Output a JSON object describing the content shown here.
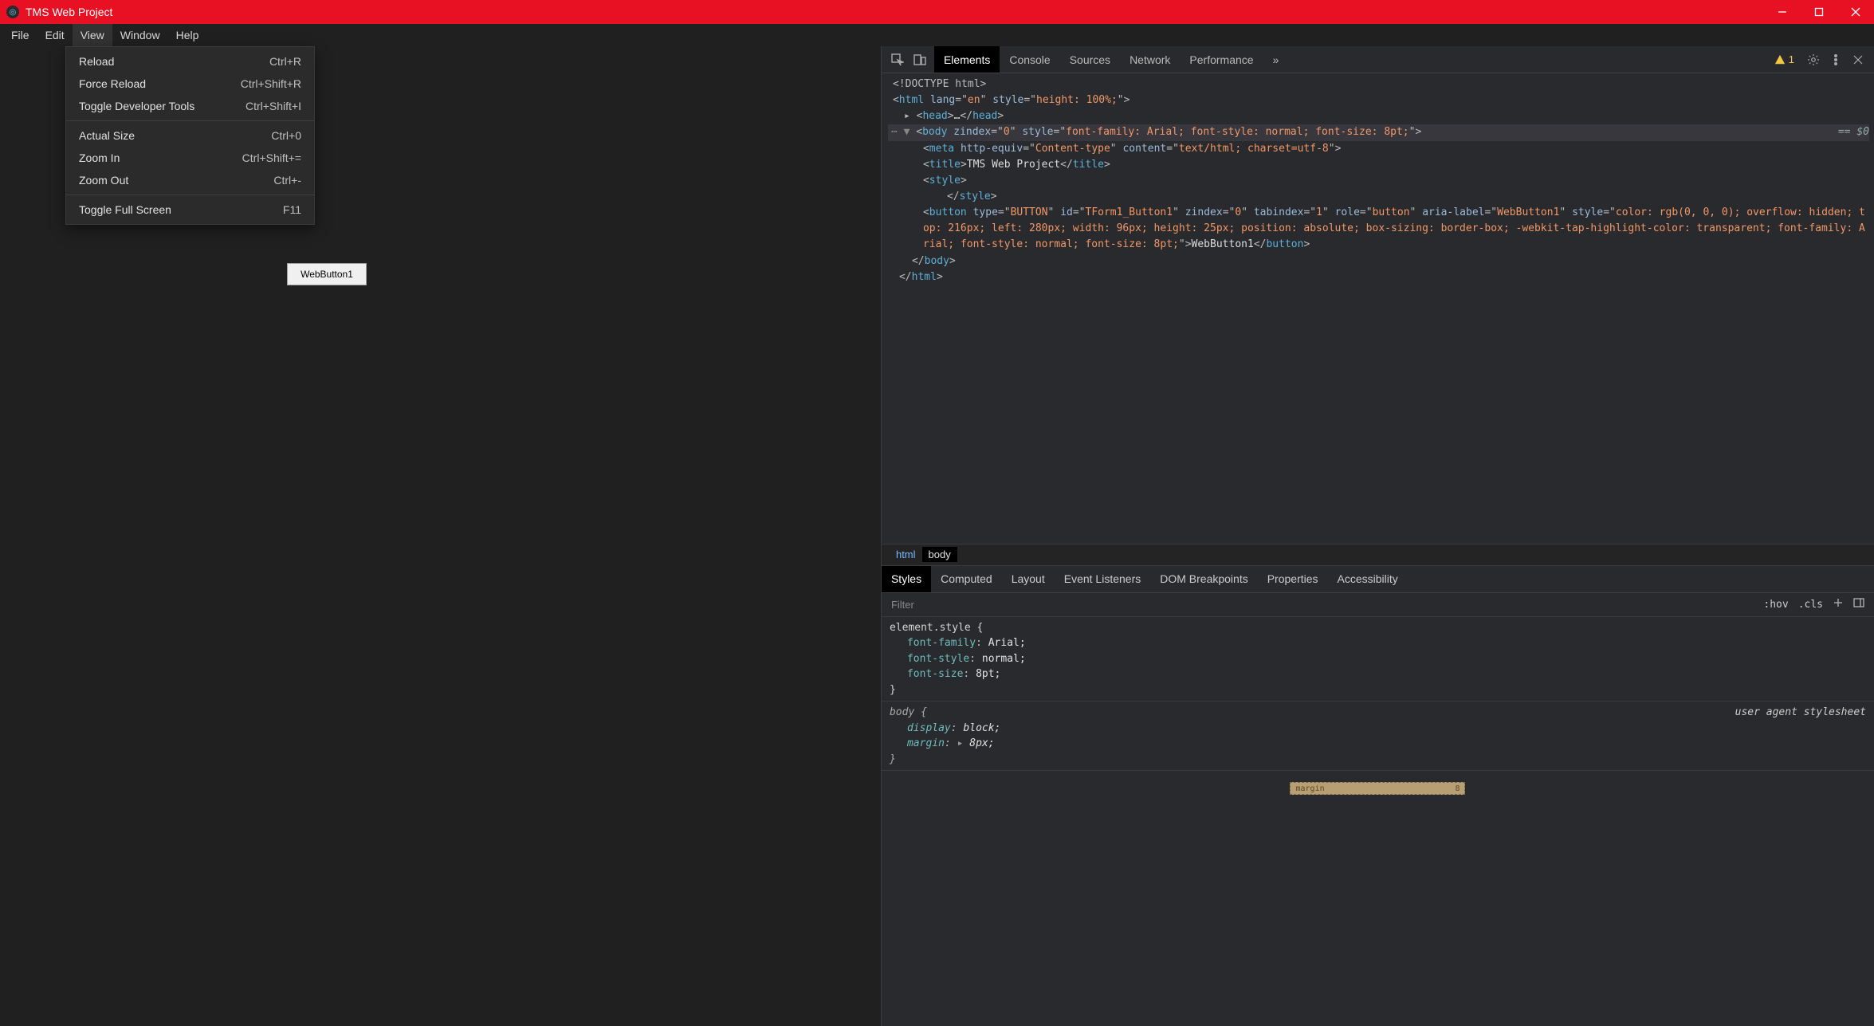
{
  "window": {
    "title": "TMS Web Project"
  },
  "menu": {
    "items": [
      "File",
      "Edit",
      "View",
      "Window",
      "Help"
    ],
    "active_index": 2
  },
  "dropdown": {
    "groups": [
      [
        {
          "label": "Reload",
          "accel": "Ctrl+R"
        },
        {
          "label": "Force Reload",
          "accel": "Ctrl+Shift+R"
        },
        {
          "label": "Toggle Developer Tools",
          "accel": "Ctrl+Shift+I"
        }
      ],
      [
        {
          "label": "Actual Size",
          "accel": "Ctrl+0"
        },
        {
          "label": "Zoom In",
          "accel": "Ctrl+Shift+="
        },
        {
          "label": "Zoom Out",
          "accel": "Ctrl+-"
        }
      ],
      [
        {
          "label": "Toggle Full Screen",
          "accel": "F11"
        }
      ]
    ]
  },
  "page": {
    "button_label": "WebButton1"
  },
  "devtools": {
    "tabs": [
      "Elements",
      "Console",
      "Sources",
      "Network",
      "Performance"
    ],
    "active_tab": 0,
    "warn_count": "1",
    "crumbs": [
      "html",
      "body"
    ],
    "active_crumb": 1,
    "subtabs": [
      "Styles",
      "Computed",
      "Layout",
      "Event Listeners",
      "DOM Breakpoints",
      "Properties",
      "Accessibility"
    ],
    "active_subtab": 0,
    "filter_placeholder": "Filter",
    "filter_buttons": {
      "hov": ":hov",
      "cls": ".cls"
    },
    "selected_eq": "== $0",
    "dom": {
      "doctype": "<!DOCTYPE html>",
      "html_open_tag": "html",
      "html_lang_attr": "lang",
      "html_lang_val": "en",
      "html_style_attr": "style",
      "html_style_val": "height: 100%;",
      "head_tag": "head",
      "head_ellipsis": "…",
      "body_tag": "body",
      "body_zattr": "zindex",
      "body_zval": "0",
      "body_style_attr": "style",
      "body_style_val": "font-family: Arial; font-style: normal; font-size: 8pt;",
      "meta_tag": "meta",
      "meta_a1": "http-equiv",
      "meta_v1": "Content-type",
      "meta_a2": "content",
      "meta_v2": "text/html; charset=utf-8",
      "title_tag": "title",
      "title_text": "TMS Web Project",
      "style_tag": "style",
      "button_tag": "button",
      "btn_a_type": "type",
      "btn_v_type": "BUTTON",
      "btn_a_id": "id",
      "btn_v_id": "TForm1_Button1",
      "btn_a_z": "zindex",
      "btn_v_z": "0",
      "btn_a_tab": "tabindex",
      "btn_v_tab": "1",
      "btn_a_role": "role",
      "btn_v_role": "button",
      "btn_a_aria": "aria-label",
      "btn_v_aria": "WebButton1",
      "btn_a_style": "style",
      "btn_v_style": "color: rgb(0, 0, 0); overflow: hidden; top: 216px; left: 280px; width: 96px; height: 25px; position: absolute; box-sizing: border-box; -webkit-tap-highlight-color: transparent; font-family: Arial; font-style: normal; font-size: 8pt;",
      "btn_text": "WebButton1"
    },
    "styles": {
      "rule1": {
        "selector": "element.style {",
        "props": [
          {
            "k": "font-family",
            "v": "Arial;"
          },
          {
            "k": "font-style",
            "v": "normal;"
          },
          {
            "k": "font-size",
            "v": "8pt;"
          }
        ],
        "close": "}"
      },
      "rule2": {
        "selector": "body {",
        "ua": "user agent stylesheet",
        "props": [
          {
            "k": "display",
            "v": "block;",
            "em": true
          },
          {
            "k": "margin",
            "v": "8px;",
            "expand": "▸",
            "em": true
          }
        ],
        "close": "}"
      }
    },
    "boxmodel": {
      "label": "margin",
      "top": "8"
    }
  }
}
